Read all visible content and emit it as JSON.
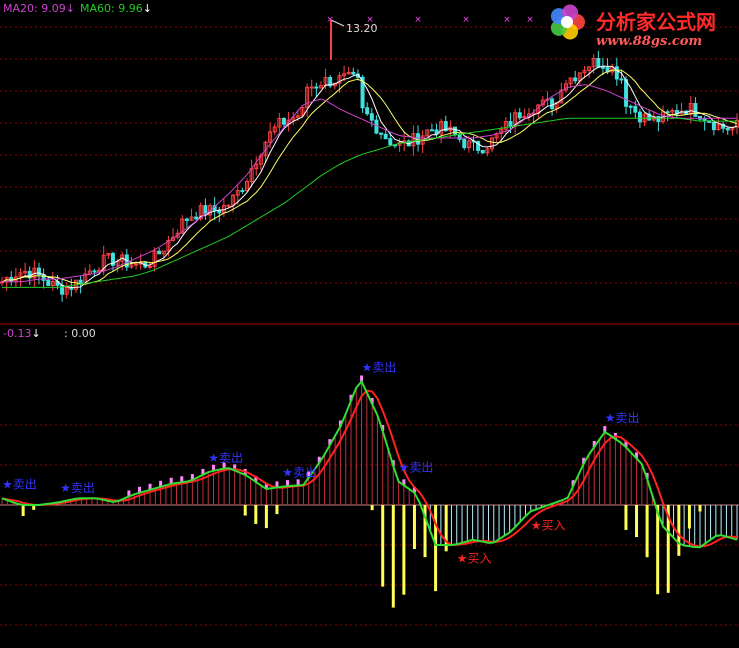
{
  "header": {
    "ma20_label": "MA20: 9.09",
    "ma60_label": "MA60: 9.96",
    "arrow_down": "↓",
    "high_price_label": "13.20"
  },
  "indicator_header": {
    "value_left": "-0.13",
    "arrow_down": "↓",
    "value_right": ": 0.00"
  },
  "logo": {
    "title": "分析家公式网",
    "url": "www.88gs.com"
  },
  "colors": {
    "background": "#000000",
    "grid": "#8b0000",
    "ma20": "#cc44cc",
    "ma60": "#22cc22",
    "candle_up": "#ff4040",
    "candle_down": "#40e0e0",
    "sell_signal": "#3333ff",
    "buy_signal": "#ff2222",
    "macd_pos_bar": "#c0303a",
    "macd_neg_bar": "#ffff55",
    "macd_neg_light": "#b0f0ff",
    "dif_line": "#33dd33",
    "dea_line": "#ff2222",
    "peak_bar": "#ff88ff",
    "logo_red": "#ff2a2a"
  },
  "chart_data": [
    {
      "type": "line",
      "title": "",
      "series": [
        {
          "name": "MA20",
          "values": [
            4.5,
            4.5,
            4.6,
            4.6,
            4.7,
            4.8,
            5.0,
            5.3,
            5.6,
            6.0,
            6.5,
            7.0,
            7.6,
            8.3,
            9.2,
            10.0,
            10.8,
            11.0,
            10.6,
            10.3,
            10.0,
            9.7,
            9.6,
            9.6,
            9.6,
            9.6,
            9.7,
            9.9,
            10.4,
            11.0,
            11.4,
            11.5,
            11.3,
            11.0,
            10.7,
            10.4,
            10.3,
            10.3,
            10.3,
            10.3
          ]
        },
        {
          "name": "MA60",
          "values": [
            4.3,
            4.3,
            4.3,
            4.3,
            4.4,
            4.5,
            4.6,
            4.7,
            4.9,
            5.2,
            5.5,
            5.8,
            6.1,
            6.5,
            6.9,
            7.3,
            7.8,
            8.3,
            8.7,
            9.0,
            9.2,
            9.4,
            9.5,
            9.6,
            9.7,
            9.8,
            9.9,
            10.0,
            10.1,
            10.2,
            10.3,
            10.3,
            10.3,
            10.3,
            10.3,
            10.3,
            10.3,
            10.2,
            10.2,
            10.2
          ]
        }
      ],
      "ylim": [
        3.5,
        14.0
      ]
    },
    {
      "type": "bar",
      "title": "",
      "series": [
        {
          "name": "DIF",
          "values": [
            0.05,
            0.0,
            0.0,
            0.02,
            0.05,
            0.05,
            0.02,
            0.08,
            0.12,
            0.16,
            0.18,
            0.25,
            0.28,
            0.22,
            0.12,
            0.14,
            0.15,
            0.35,
            0.6,
            0.95,
            0.65,
            0.18,
            0.08,
            -0.3,
            -0.3,
            -0.26,
            -0.29,
            -0.2,
            -0.05,
            0.0,
            0.05,
            0.35,
            0.55,
            0.45,
            0.3,
            -0.15,
            -0.3,
            -0.32,
            -0.22,
            -0.26
          ]
        }
      ],
      "ylim": [
        -1.2,
        1.2
      ],
      "annotations": [
        {
          "text": "卖出",
          "index": 0
        },
        {
          "text": "卖出",
          "index": 3
        },
        {
          "text": "卖出",
          "index": 11
        },
        {
          "text": "卖出",
          "index": 15
        },
        {
          "text": "卖出",
          "index": 19
        },
        {
          "text": "卖出",
          "index": 21
        },
        {
          "text": "卖出",
          "index": 32
        },
        {
          "text": "买入",
          "index": 24
        },
        {
          "text": "买入",
          "index": 28
        }
      ]
    }
  ]
}
